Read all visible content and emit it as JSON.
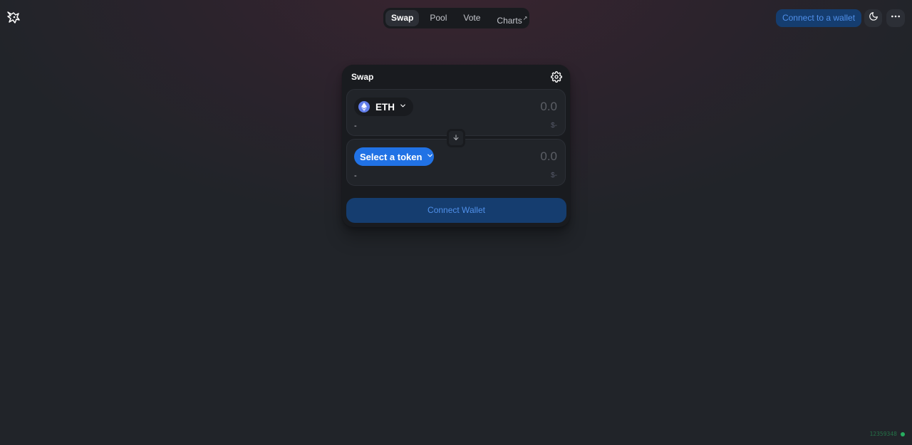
{
  "header": {
    "logo_icon": "unicorn-logo-icon",
    "nav": [
      {
        "label": "Swap",
        "active": true
      },
      {
        "label": "Pool",
        "active": false
      },
      {
        "label": "Vote",
        "active": false
      },
      {
        "label": "Charts",
        "active": false,
        "external_marker": "↗"
      }
    ],
    "connect_label": "Connect to a wallet",
    "theme_icon": "moon-icon",
    "more_icon": "more-horizontal-icon"
  },
  "swap": {
    "title": "Swap",
    "settings_icon": "gear-icon",
    "from": {
      "token_symbol": "ETH",
      "token_icon": "ethereum-icon",
      "amount_placeholder": "0.0",
      "balance": "-",
      "fiat_value": "$-"
    },
    "switch_icon": "arrow-down-icon",
    "to": {
      "select_label": "Select a token",
      "amount_placeholder": "0.0",
      "balance": "-",
      "fiat_value": "$-"
    },
    "connect_wallet_label": "Connect Wallet"
  },
  "footer": {
    "block_number": "12359348"
  },
  "colors": {
    "accent_blue": "#2172e5",
    "connect_bg": "#153d6f",
    "connect_text": "#5090ea",
    "card_bg": "#191b1f",
    "panel_bg": "#212429",
    "status_green": "#27ae60"
  }
}
